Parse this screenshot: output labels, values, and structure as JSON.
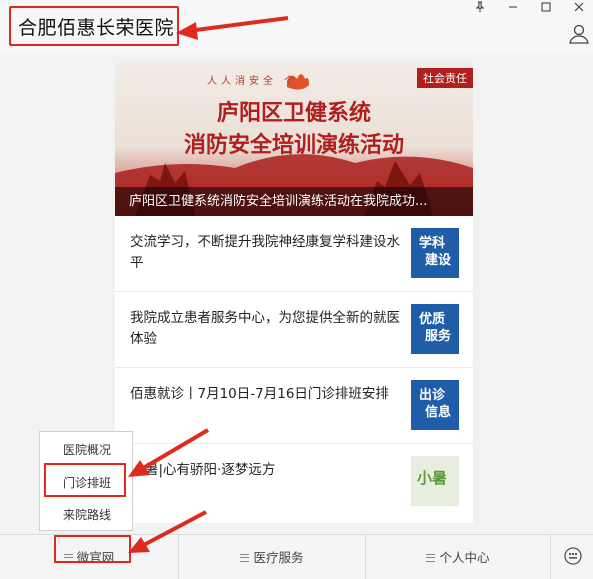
{
  "window": {
    "title": "合肥佰惠长荣医院",
    "pin_icon": "pin-icon",
    "min_icon": "minimize-icon",
    "max_icon": "maximize-icon",
    "close_icon": "close-icon",
    "user_icon": "user-icon"
  },
  "banner": {
    "slogan": "人人消安全 个",
    "tag": "社会责任",
    "headline_1": "庐阳区卫健系统",
    "headline_2": "消防安全培训演练活动",
    "caption": "庐阳区卫健系统消防安全培训演练活动在我院成功..."
  },
  "news": [
    {
      "title": "交流学习，不断提升我院神经康复学科建设水平",
      "thumb_text_1": "学科",
      "thumb_text_2": "建设",
      "thumb_color": "#1f5da8"
    },
    {
      "title": "我院成立患者服务中心，为您提供全新的就医体验",
      "thumb_text_1": "优质",
      "thumb_text_2": "服务",
      "thumb_color": "#1f5da8"
    },
    {
      "title": "佰惠就诊丨7月10日-7月16日门诊排班安排",
      "thumb_text_1": "出诊",
      "thumb_text_2": "信息",
      "thumb_color": "#1f5da8"
    },
    {
      "title": "暑|心有骄阳·逐梦远方",
      "thumb_text_1": "小暑",
      "thumb_text_2": "",
      "thumb_color": "#e7eedf"
    }
  ],
  "popup_menu": {
    "items": [
      "医院概况",
      "门诊排班",
      "来院路线"
    ]
  },
  "bottom_menu": {
    "tabs": [
      "微官网",
      "医疗服务",
      "个人中心"
    ],
    "keyboard_icon": "keyboard-icon"
  },
  "colors": {
    "highlight": "#e02a1f",
    "thumb_blue": "#1f5da8"
  }
}
